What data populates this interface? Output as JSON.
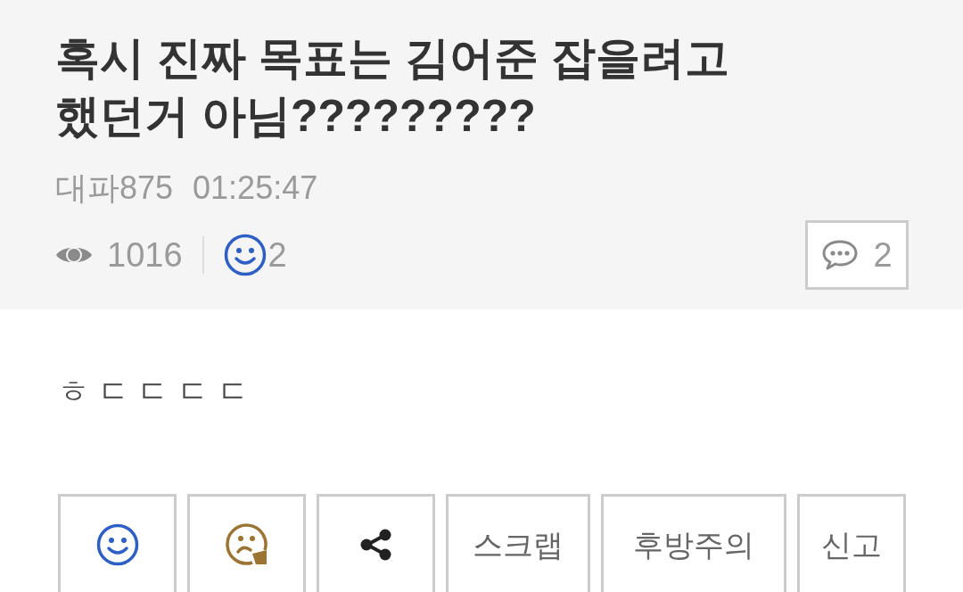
{
  "post": {
    "title": "혹시 진짜 목표는 김어준 잡을려고 했던거 아님?????????",
    "author": "대파875",
    "time": "01:25:47",
    "views": "1016",
    "likes": "2",
    "comments": "2"
  },
  "body": "ㅎ ㄷ ㄷ ㄷ ㄷ",
  "actions": [
    "스크랩",
    "후방주의",
    "신고"
  ]
}
